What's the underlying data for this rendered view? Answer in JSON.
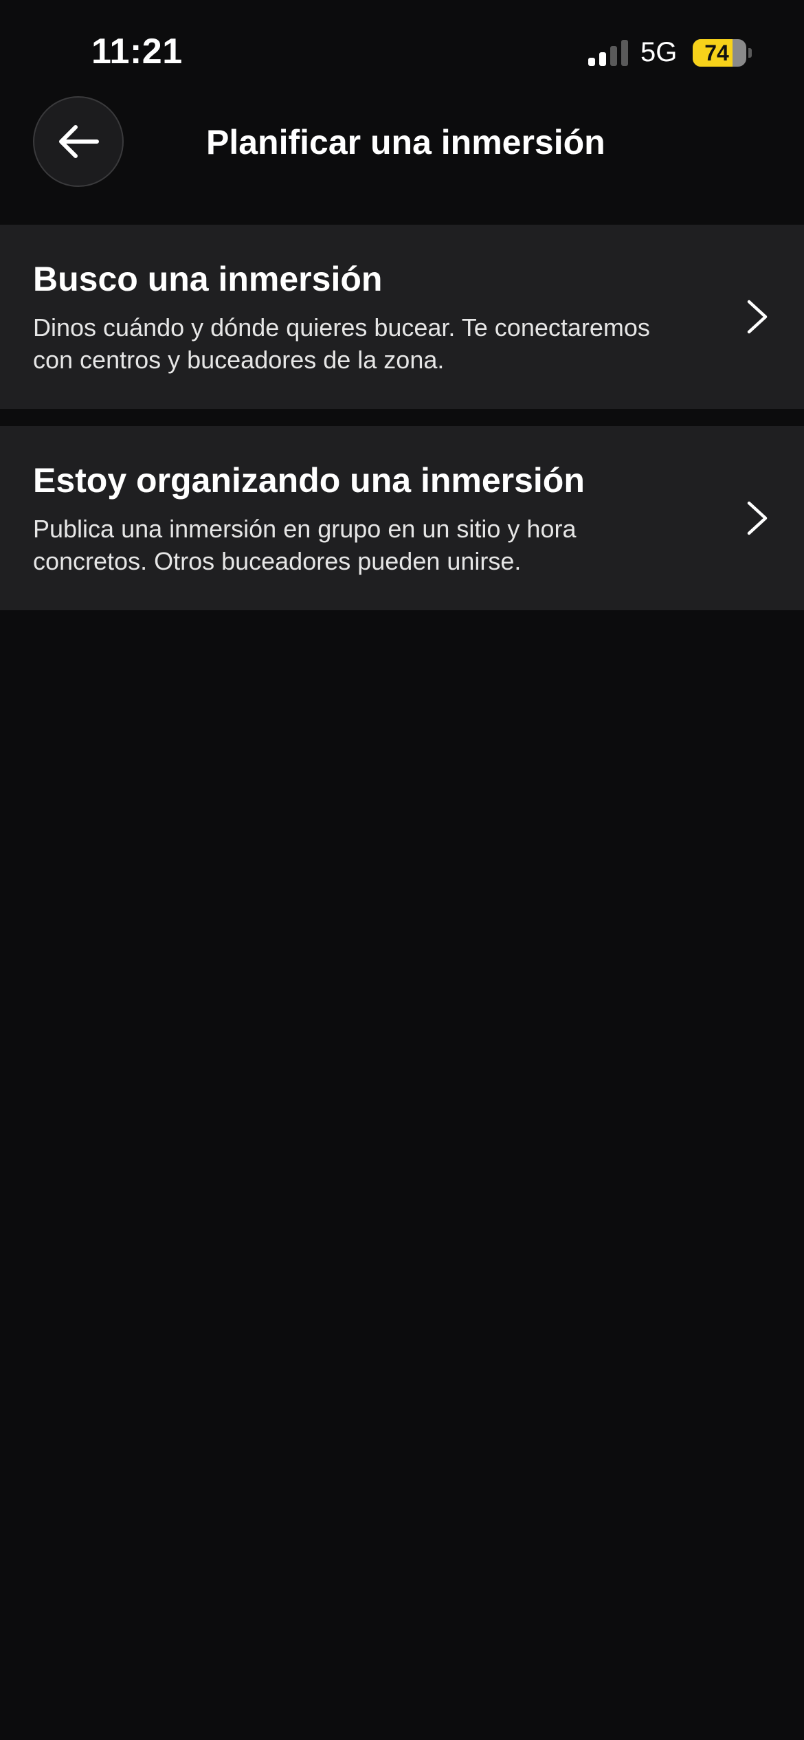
{
  "status_bar": {
    "time": "11:21",
    "network": "5G",
    "battery_level": "74",
    "battery_fraction": 0.74,
    "signal_bars_active": 2,
    "signal_bars_total": 4,
    "icons": [
      "cellular-signal-icon",
      "battery-icon"
    ]
  },
  "header": {
    "back_icon": "arrow-left-icon",
    "title": "Planificar una inmersión"
  },
  "options": [
    {
      "title": "Busco una inmersión",
      "description": "Dinos cuándo y dónde quieres bucear. Te conectaremos con centros y buceadores de la zona.",
      "icon": "chevron-right-icon"
    },
    {
      "title": "Estoy organizando una inmersión",
      "description": "Publica una inmersión en grupo en un sitio y hora concretos. Otros buceadores pueden unirse.",
      "icon": "chevron-right-icon"
    }
  ],
  "colors": {
    "background": "#0c0c0d",
    "card": "#1f1f21",
    "battery_accent": "#f7d21a",
    "text": "#ffffff"
  }
}
